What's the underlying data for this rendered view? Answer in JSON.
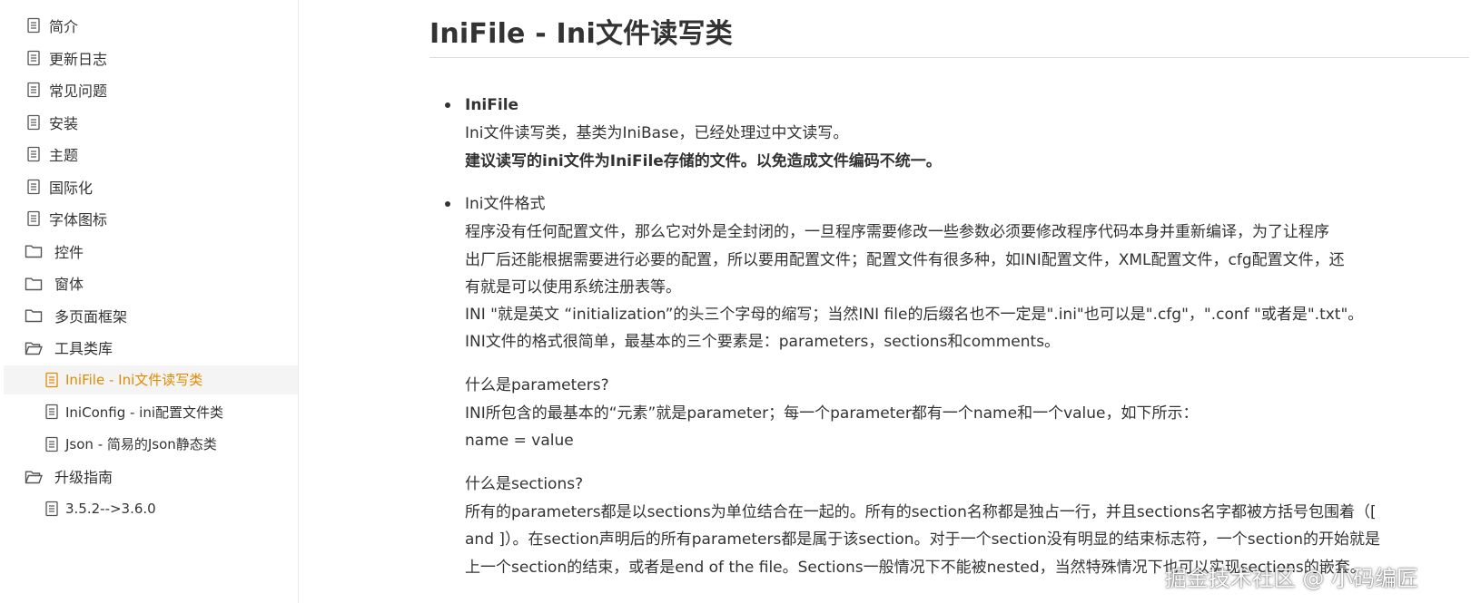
{
  "sidebar": {
    "items": [
      {
        "label": "简介",
        "icon": "document-icon",
        "level": 0
      },
      {
        "label": "更新日志",
        "icon": "document-icon",
        "level": 0
      },
      {
        "label": "常见问题",
        "icon": "document-icon",
        "level": 0
      },
      {
        "label": "安装",
        "icon": "document-icon",
        "level": 0
      },
      {
        "label": "主题",
        "icon": "document-icon",
        "level": 0
      },
      {
        "label": "国际化",
        "icon": "document-icon",
        "level": 0
      },
      {
        "label": "字体图标",
        "icon": "document-icon",
        "level": 0
      },
      {
        "label": "控件",
        "icon": "folder-icon",
        "level": 0
      },
      {
        "label": "窗体",
        "icon": "folder-icon",
        "level": 0
      },
      {
        "label": "多页面框架",
        "icon": "folder-icon",
        "level": 0
      },
      {
        "label": "工具类库",
        "icon": "folder-open-icon",
        "level": 0
      },
      {
        "label": "IniFile - Ini文件读写类",
        "icon": "document-icon",
        "level": 1,
        "active": true
      },
      {
        "label": "IniConfig - ini配置文件类",
        "icon": "document-icon",
        "level": 1
      },
      {
        "label": "Json - 简易的Json静态类",
        "icon": "document-icon",
        "level": 1
      },
      {
        "label": "升级指南",
        "icon": "folder-open-icon",
        "level": 0
      },
      {
        "label": "3.5.2-->3.6.0",
        "icon": "document-icon",
        "level": 1
      }
    ],
    "active_color": "#e08a00"
  },
  "content": {
    "title": "IniFile - Ini文件读写类",
    "section1": {
      "heading": "IniFile",
      "line1": "Ini文件读写类，基类为IniBase，已经处理过中文读写。",
      "line2": "建议读写的ini文件为IniFile存储的文件。以免造成文件编码不统一。"
    },
    "section2": {
      "heading": "Ini文件格式",
      "p1": "程序没有任何配置文件，那么它对外是全封闭的，一旦程序需要修改一些参数必须要修改程序代码本身并重新编译，为了让程序",
      "p2": "出厂后还能根据需要进行必要的配置，所以要用配置文件；配置文件有很多种，如INI配置文件，XML配置文件，cfg配置文件，还",
      "p3": "有就是可以使用系统注册表等。",
      "p4": "INI \"就是英文 “initialization”的头三个字母的缩写；当然INI file的后缀名也不一定是\".ini\"也可以是\".cfg\"，\".conf \"或者是\".txt\"。",
      "p5": "INI文件的格式很简单，最基本的三个要素是：parameters，sections和comments。",
      "q1": "什么是parameters?",
      "q1a": "INI所包含的最基本的“元素”就是parameter；每一个parameter都有一个name和一个value，如下所示：",
      "q1b": "name = value",
      "q2": "什么是sections?",
      "q2a": "所有的parameters都是以sections为单位结合在一起的。所有的section名称都是独占一行，并且sections名字都被方括号包围着（[",
      "q2b": "and ]）。在section声明后的所有parameters都是属于该section。对于一个section没有明显的结束标志符，一个section的开始就是",
      "q2c": "上一个section的结束，或者是end of the file。Sections一般情况下不能被nested，当然特殊情况下也可以实现sections的嵌套。"
    }
  },
  "watermark": "掘金技术社区 @ 小码编匠"
}
